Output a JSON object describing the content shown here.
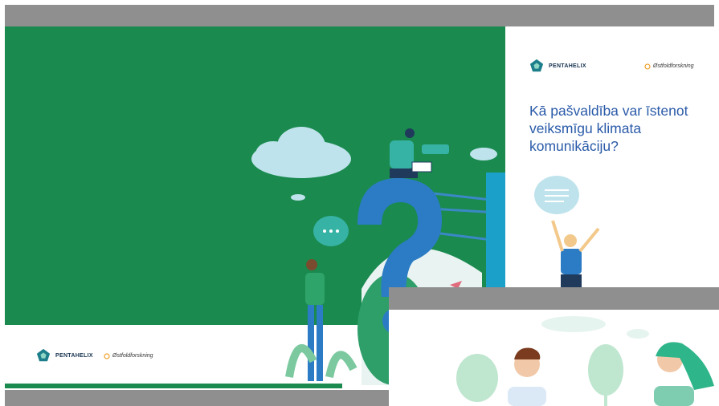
{
  "slide1": {
    "logo_text": "PENTAHELIX",
    "partner_text": "Østfoldforskning"
  },
  "slide_right": {
    "logo_text": "PENTAHELIX",
    "partner_text": "Østfoldforskning",
    "title": "Kā pašvaldība var īstenot veiksmīgu klimata komunikāciju?"
  },
  "colors": {
    "green": "#1a8a4f",
    "blue_text": "#2a5aa8",
    "frame_gray": "#8f8f8f"
  }
}
